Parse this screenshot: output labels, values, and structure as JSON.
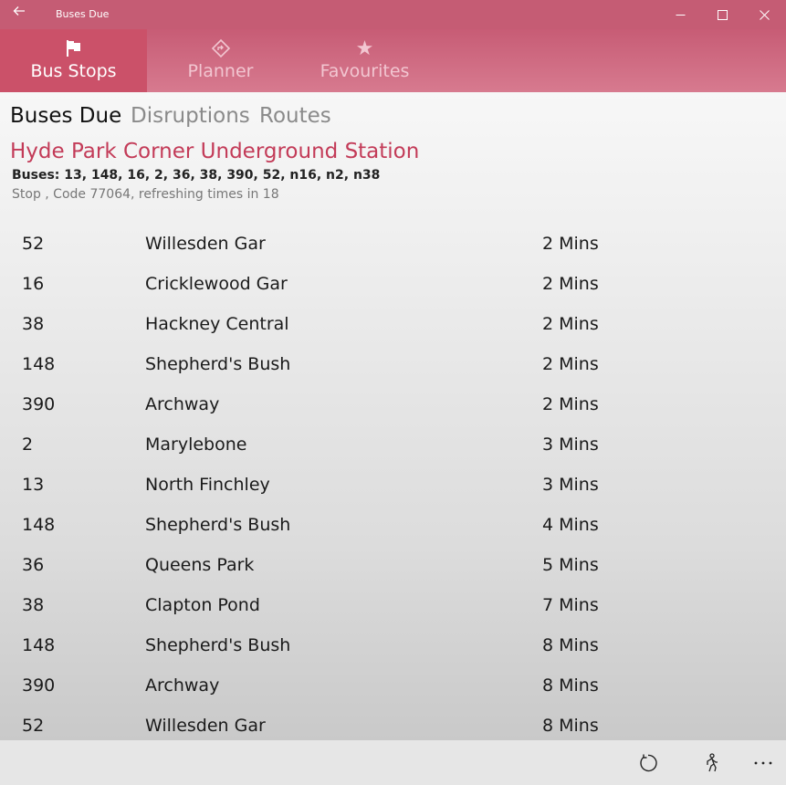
{
  "window": {
    "title": "Buses Due",
    "back_icon": "back-arrow-icon",
    "accent_color": "#c55c74"
  },
  "nav": {
    "tabs": [
      {
        "label": "Bus Stops",
        "icon": "flag-icon",
        "active": true
      },
      {
        "label": "Planner",
        "icon": "directions-diamond-icon",
        "active": false
      },
      {
        "label": "Favourites",
        "icon": "star-icon",
        "active": false
      }
    ]
  },
  "subtabs": [
    "Buses Due",
    "Disruptions",
    "Routes"
  ],
  "stop": {
    "name": "Hyde Park Corner Underground Station",
    "buses": "Buses: 13, 148, 16, 2, 36, 38, 390, 52, n16, n2, n38",
    "info": "Stop , Code 77064, refreshing times in 18",
    "name_color": "#c33b58"
  },
  "arrivals": [
    {
      "route": "52",
      "destination": "Willesden Gar",
      "due": "2 Mins"
    },
    {
      "route": "16",
      "destination": "Cricklewood Gar",
      "due": "2 Mins"
    },
    {
      "route": "38",
      "destination": "Hackney Central",
      "due": "2 Mins"
    },
    {
      "route": "148",
      "destination": "Shepherd's Bush",
      "due": "2 Mins"
    },
    {
      "route": "390",
      "destination": "Archway",
      "due": "2 Mins"
    },
    {
      "route": "2",
      "destination": "Marylebone",
      "due": "3 Mins"
    },
    {
      "route": "13",
      "destination": "North Finchley",
      "due": "3 Mins"
    },
    {
      "route": "148",
      "destination": "Shepherd's Bush",
      "due": "4 Mins"
    },
    {
      "route": "36",
      "destination": "Queens Park",
      "due": "5 Mins"
    },
    {
      "route": "38",
      "destination": "Clapton Pond",
      "due": "7 Mins"
    },
    {
      "route": "148",
      "destination": "Shepherd's Bush",
      "due": "8 Mins"
    },
    {
      "route": "390",
      "destination": "Archway",
      "due": "8 Mins"
    },
    {
      "route": "52",
      "destination": "Willesden Gar",
      "due": "8 Mins"
    }
  ],
  "appbar": {
    "buttons": [
      "refresh-icon",
      "walking-person-icon",
      "more-icon"
    ]
  }
}
